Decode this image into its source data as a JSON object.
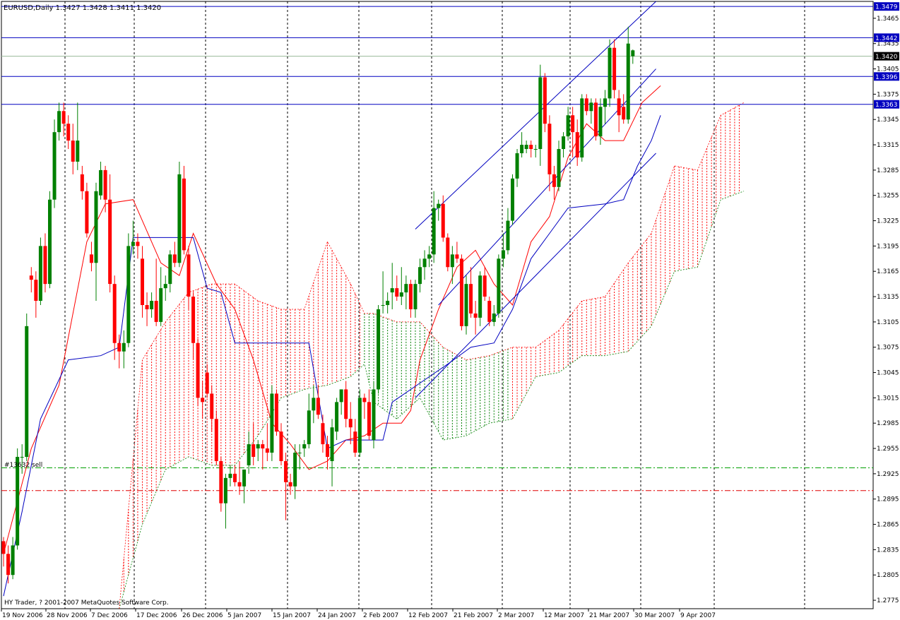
{
  "chart_data": {
    "type": "candlestick",
    "title": "EURUSD,Daily  1.3427 1.3428 1.3411 1.3420",
    "footer": "HY Trader, ? 2001-2007 MetaQuotes Software Corp.",
    "order_label": "#13632 sell",
    "ylim": [
      1.2765,
      1.3485
    ],
    "y_ticks": [
      "1.3465",
      "1.3435",
      "1.3405",
      "1.3375",
      "1.3345",
      "1.3315",
      "1.3285",
      "1.3255",
      "1.3225",
      "1.3195",
      "1.3165",
      "1.3135",
      "1.3105",
      "1.3075",
      "1.3045",
      "1.3015",
      "1.2985",
      "1.2955",
      "1.2925",
      "1.2895",
      "1.2865",
      "1.2835",
      "1.2805",
      "1.2775"
    ],
    "x_ticks": [
      "19 Nov 2006",
      "28 Nov 2006",
      "7 Dec 2006",
      "17 Dec 2006",
      "26 Dec 2006",
      "5 Jan 2007",
      "15 Jan 2007",
      "24 Jan 2007",
      "2 Feb 2007",
      "12 Feb 2007",
      "21 Feb 2007",
      "2 Mar 2007",
      "12 Mar 2007",
      "21 Mar 2007",
      "30 Mar 2007",
      "9 Apr 2007"
    ],
    "levels": [
      {
        "value": 1.3479,
        "label": "1.3479",
        "color": "#0000c0"
      },
      {
        "value": 1.3442,
        "label": "1.3442",
        "color": "#0000c0"
      },
      {
        "value": 1.342,
        "label": "1.3420",
        "color": "#000000"
      },
      {
        "value": 1.3396,
        "label": "1.3396",
        "color": "#0000c0"
      },
      {
        "value": 1.3363,
        "label": "1.3363",
        "color": "#0000c0"
      }
    ],
    "hlines": [
      {
        "value": 1.2932,
        "color": "#00a000",
        "style": "dashdot"
      },
      {
        "value": 1.2905,
        "color": "#e00000",
        "style": "dashdot"
      }
    ],
    "colors": {
      "bull": "#008000",
      "bear": "#ff0000",
      "tenkan": "#ff0000",
      "kijun": "#0000c0",
      "channel": "#0000c0",
      "cloud_bear": "#ff0000",
      "cloud_bull": "#008000"
    },
    "candles": [
      [
        1.2845,
        1.285,
        1.2815,
        1.283
      ],
      [
        1.283,
        1.284,
        1.2795,
        1.2805
      ],
      [
        1.2805,
        1.285,
        1.28,
        1.284
      ],
      [
        1.284,
        1.2955,
        1.2835,
        1.2945
      ],
      [
        1.2945,
        1.296,
        1.2925,
        1.2945
      ],
      [
        1.2945,
        1.3115,
        1.294,
        1.31
      ],
      [
        1.316,
        1.317,
        1.314,
        1.3155
      ],
      [
        1.3155,
        1.3165,
        1.311,
        1.313
      ],
      [
        1.313,
        1.3205,
        1.3125,
        1.3195
      ],
      [
        1.3195,
        1.321,
        1.314,
        1.315
      ],
      [
        1.315,
        1.326,
        1.3145,
        1.325
      ],
      [
        1.325,
        1.3345,
        1.324,
        1.333
      ],
      [
        1.333,
        1.3365,
        1.332,
        1.3355
      ],
      [
        1.3355,
        1.3365,
        1.3325,
        1.334
      ],
      [
        1.334,
        1.335,
        1.331,
        1.332
      ],
      [
        1.332,
        1.334,
        1.328,
        1.3295
      ],
      [
        1.3295,
        1.3365,
        1.3285,
        1.332
      ],
      [
        1.328,
        1.329,
        1.325,
        1.326
      ],
      [
        1.326,
        1.327,
        1.3205,
        1.321
      ],
      [
        1.3185,
        1.32,
        1.3165,
        1.3175
      ],
      [
        1.3175,
        1.327,
        1.313,
        1.326
      ],
      [
        1.3255,
        1.3295,
        1.325,
        1.3285
      ],
      [
        1.3285,
        1.329,
        1.3235,
        1.325
      ],
      [
        1.325,
        1.328,
        1.314,
        1.315
      ],
      [
        1.315,
        1.316,
        1.306,
        1.308
      ],
      [
        1.308,
        1.309,
        1.305,
        1.307
      ],
      [
        1.307,
        1.3095,
        1.305,
        1.308
      ],
      [
        1.308,
        1.321,
        1.3075,
        1.3195
      ],
      [
        1.3195,
        1.3225,
        1.3185,
        1.32
      ],
      [
        1.32,
        1.321,
        1.318,
        1.3195
      ],
      [
        1.318,
        1.3195,
        1.311,
        1.3125
      ],
      [
        1.3125,
        1.314,
        1.31,
        1.312
      ],
      [
        1.312,
        1.314,
        1.311,
        1.313
      ],
      [
        1.313,
        1.318,
        1.31,
        1.3105
      ],
      [
        1.3105,
        1.317,
        1.31,
        1.3145
      ],
      [
        1.3145,
        1.316,
        1.313,
        1.315
      ],
      [
        1.315,
        1.319,
        1.314,
        1.3185
      ],
      [
        1.3185,
        1.32,
        1.317,
        1.3175
      ],
      [
        1.3175,
        1.3295,
        1.317,
        1.328
      ],
      [
        1.3275,
        1.329,
        1.3185,
        1.319
      ],
      [
        1.3185,
        1.3195,
        1.312,
        1.3135
      ],
      [
        1.3135,
        1.314,
        1.306,
        1.308
      ],
      [
        1.308,
        1.3085,
        1.3005,
        1.3015
      ],
      [
        1.3015,
        1.3035,
        1.299,
        1.301
      ],
      [
        1.3045,
        1.3055,
        1.3015,
        1.302
      ],
      [
        1.302,
        1.303,
        1.2975,
        1.299
      ],
      [
        1.299,
        1.3,
        1.2935,
        1.294
      ],
      [
        1.294,
        1.2945,
        1.288,
        1.289
      ],
      [
        1.289,
        1.2925,
        1.286,
        1.292
      ],
      [
        1.292,
        1.2935,
        1.291,
        1.2925
      ],
      [
        1.2925,
        1.2935,
        1.291,
        1.2915
      ],
      [
        1.2915,
        1.294,
        1.29,
        1.291
      ],
      [
        1.291,
        1.293,
        1.289,
        1.293
      ],
      [
        1.2935,
        1.2975,
        1.2925,
        1.296
      ],
      [
        1.296,
        1.2985,
        1.2935,
        1.2945
      ],
      [
        1.2955,
        1.2965,
        1.294,
        1.296
      ],
      [
        1.296,
        1.2965,
        1.293,
        1.2955
      ],
      [
        1.2955,
        1.2985,
        1.294,
        1.295
      ],
      [
        1.295,
        1.303,
        1.294,
        1.302
      ],
      [
        1.302,
        1.3025,
        1.297,
        1.2975
      ],
      [
        1.2975,
        1.2985,
        1.2935,
        1.294
      ],
      [
        1.294,
        1.295,
        1.287,
        1.2915
      ],
      [
        1.2915,
        1.2925,
        1.29,
        1.291
      ],
      [
        1.291,
        1.296,
        1.2895,
        1.295
      ],
      [
        1.295,
        1.296,
        1.293,
        1.295
      ],
      [
        1.2955,
        1.2965,
        1.2945,
        1.296
      ],
      [
        1.296,
        1.302,
        1.2955,
        1.3
      ],
      [
        1.3,
        1.303,
        1.2985,
        1.3015
      ],
      [
        1.3015,
        1.303,
        1.299,
        1.2995
      ],
      [
        1.2985,
        1.2995,
        1.295,
        1.296
      ],
      [
        1.296,
        1.297,
        1.293,
        1.2945
      ],
      [
        1.294,
        1.299,
        1.291,
        1.298
      ],
      [
        1.2975,
        1.3015,
        1.2965,
        1.301
      ],
      [
        1.301,
        1.3025,
        1.2995,
        1.3025
      ],
      [
        1.3025,
        1.3035,
        1.298,
        1.299
      ],
      [
        1.299,
        1.301,
        1.296,
        1.298
      ],
      [
        1.2975,
        1.299,
        1.2945,
        1.295
      ],
      [
        1.295,
        1.3025,
        1.2945,
        1.3015
      ],
      [
        1.3015,
        1.302,
        1.299,
        1.301
      ],
      [
        1.301,
        1.3025,
        1.2965,
        1.297
      ],
      [
        1.2965,
        1.3035,
        1.2955,
        1.3025
      ],
      [
        1.3025,
        1.3125,
        1.302,
        1.312
      ],
      [
        1.3125,
        1.3165,
        1.3115,
        1.3125
      ],
      [
        1.3125,
        1.314,
        1.3115,
        1.313
      ],
      [
        1.314,
        1.3175,
        1.312,
        1.3145
      ],
      [
        1.3145,
        1.316,
        1.313,
        1.3135
      ],
      [
        1.3135,
        1.317,
        1.3125,
        1.314
      ],
      [
        1.314,
        1.316,
        1.312,
        1.315
      ],
      [
        1.315,
        1.3155,
        1.311,
        1.312
      ],
      [
        1.312,
        1.3155,
        1.311,
        1.315
      ],
      [
        1.315,
        1.318,
        1.314,
        1.317
      ],
      [
        1.317,
        1.319,
        1.3155,
        1.318
      ],
      [
        1.318,
        1.3195,
        1.317,
        1.3185
      ],
      [
        1.3185,
        1.326,
        1.3175,
        1.324
      ],
      [
        1.324,
        1.325,
        1.3225,
        1.3245
      ],
      [
        1.3245,
        1.3255,
        1.32,
        1.3205
      ],
      [
        1.3205,
        1.321,
        1.3165,
        1.317
      ],
      [
        1.317,
        1.3195,
        1.315,
        1.3185
      ],
      [
        1.3185,
        1.32,
        1.3175,
        1.318
      ],
      [
        1.318,
        1.3185,
        1.3095,
        1.31
      ],
      [
        1.31,
        1.316,
        1.309,
        1.315
      ],
      [
        1.315,
        1.317,
        1.311,
        1.3115
      ],
      [
        1.3115,
        1.313,
        1.309,
        1.311
      ],
      [
        1.311,
        1.3165,
        1.31,
        1.316
      ],
      [
        1.316,
        1.317,
        1.313,
        1.3135
      ],
      [
        1.313,
        1.3135,
        1.31,
        1.3105
      ],
      [
        1.3105,
        1.3125,
        1.31,
        1.3115
      ],
      [
        1.3115,
        1.3185,
        1.311,
        1.318
      ],
      [
        1.318,
        1.321,
        1.317,
        1.319
      ],
      [
        1.319,
        1.324,
        1.3185,
        1.3225
      ],
      [
        1.3225,
        1.328,
        1.322,
        1.3275
      ],
      [
        1.3275,
        1.331,
        1.3265,
        1.3305
      ],
      [
        1.3305,
        1.333,
        1.33,
        1.3315
      ],
      [
        1.331,
        1.332,
        1.3305,
        1.3315
      ],
      [
        1.3315,
        1.332,
        1.33,
        1.331
      ],
      [
        1.331,
        1.3315,
        1.33,
        1.331
      ],
      [
        1.331,
        1.341,
        1.329,
        1.3395
      ],
      [
        1.3395,
        1.34,
        1.333,
        1.334
      ],
      [
        1.334,
        1.335,
        1.326,
        1.328
      ],
      [
        1.328,
        1.329,
        1.325,
        1.3265
      ],
      [
        1.3265,
        1.332,
        1.326,
        1.331
      ],
      [
        1.331,
        1.333,
        1.33,
        1.3325
      ],
      [
        1.3325,
        1.336,
        1.332,
        1.335
      ],
      [
        1.335,
        1.336,
        1.33,
        1.333
      ],
      [
        1.333,
        1.3345,
        1.329,
        1.33
      ],
      [
        1.33,
        1.3375,
        1.3295,
        1.337
      ],
      [
        1.337,
        1.3375,
        1.335,
        1.3355
      ],
      [
        1.3355,
        1.337,
        1.334,
        1.3365
      ],
      [
        1.3365,
        1.337,
        1.332,
        1.3325
      ],
      [
        1.3325,
        1.337,
        1.3315,
        1.336
      ],
      [
        1.336,
        1.338,
        1.334,
        1.337
      ],
      [
        1.337,
        1.344,
        1.336,
        1.343
      ],
      [
        1.343,
        1.344,
        1.337,
        1.338
      ],
      [
        1.337,
        1.338,
        1.333,
        1.335
      ],
      [
        1.336,
        1.3375,
        1.334,
        1.3345
      ],
      [
        1.3345,
        1.3455,
        1.334,
        1.3435
      ],
      [
        1.342,
        1.3428,
        1.3411,
        1.3427
      ]
    ],
    "tenkan": [
      [
        0,
        1.283
      ],
      [
        6,
        1.2955
      ],
      [
        12,
        1.303
      ],
      [
        18,
        1.32
      ],
      [
        22,
        1.3245
      ],
      [
        28,
        1.325
      ],
      [
        34,
        1.3175
      ],
      [
        38,
        1.316
      ],
      [
        41,
        1.321
      ],
      [
        46,
        1.315
      ],
      [
        50,
        1.312
      ],
      [
        54,
        1.306
      ],
      [
        58,
        1.2985
      ],
      [
        62,
        1.296
      ],
      [
        66,
        1.293
      ],
      [
        70,
        1.294
      ],
      [
        74,
        1.2965
      ],
      [
        78,
        1.297
      ],
      [
        82,
        1.2985
      ],
      [
        86,
        1.2985
      ],
      [
        88,
        1.3
      ],
      [
        90,
        1.306
      ],
      [
        94,
        1.312
      ],
      [
        98,
        1.317
      ],
      [
        102,
        1.319
      ],
      [
        106,
        1.315
      ],
      [
        110,
        1.3125
      ],
      [
        114,
        1.32
      ],
      [
        118,
        1.323
      ],
      [
        122,
        1.33
      ],
      [
        126,
        1.334
      ],
      [
        130,
        1.332
      ],
      [
        134,
        1.332
      ],
      [
        138,
        1.3365
      ],
      [
        142,
        1.3385
      ]
    ],
    "kijun": [
      [
        0,
        1.278
      ],
      [
        4,
        1.288
      ],
      [
        8,
        1.299
      ],
      [
        14,
        1.306
      ],
      [
        21,
        1.3065
      ],
      [
        25,
        1.3075
      ],
      [
        28,
        1.3205
      ],
      [
        41,
        1.3205
      ],
      [
        44,
        1.3145
      ],
      [
        47,
        1.314
      ],
      [
        50,
        1.308
      ],
      [
        66,
        1.308
      ],
      [
        70,
        1.2955
      ],
      [
        74,
        1.2965
      ],
      [
        82,
        1.2965
      ],
      [
        84,
        1.301
      ],
      [
        92,
        1.304
      ],
      [
        96,
        1.3055
      ],
      [
        101,
        1.3075
      ],
      [
        106,
        1.308
      ],
      [
        110,
        1.312
      ],
      [
        114,
        1.318
      ],
      [
        118,
        1.321
      ],
      [
        122,
        1.324
      ],
      [
        130,
        1.3245
      ],
      [
        134,
        1.325
      ],
      [
        137,
        1.329
      ],
      [
        140,
        1.332
      ],
      [
        142,
        1.335
      ]
    ],
    "cloud": [
      [
        25,
        1.2765,
        1.2765
      ],
      [
        30,
        1.2865,
        1.306
      ],
      [
        35,
        1.293,
        1.3105
      ],
      [
        40,
        1.2945,
        1.314
      ],
      [
        45,
        1.2935,
        1.315
      ],
      [
        50,
        1.2935,
        1.315
      ],
      [
        55,
        1.297,
        1.313
      ],
      [
        60,
        1.3015,
        1.312
      ],
      [
        65,
        1.3025,
        1.312
      ],
      [
        70,
        1.303,
        1.32
      ],
      [
        75,
        1.304,
        1.315
      ],
      [
        78,
        1.3055,
        1.3115
      ],
      [
        80,
        1.301,
        1.3115
      ],
      [
        85,
        1.299,
        1.3105
      ],
      [
        90,
        1.3015,
        1.3105
      ],
      [
        95,
        1.2965,
        1.3075
      ],
      [
        100,
        1.297,
        1.306
      ],
      [
        105,
        1.2985,
        1.3065
      ],
      [
        110,
        1.299,
        1.3075
      ],
      [
        115,
        1.304,
        1.3075
      ],
      [
        120,
        1.3045,
        1.3095
      ],
      [
        125,
        1.3065,
        1.313
      ],
      [
        130,
        1.3065,
        1.3135
      ],
      [
        135,
        1.307,
        1.3175
      ],
      [
        140,
        1.31,
        1.321
      ],
      [
        145,
        1.3165,
        1.329
      ],
      [
        150,
        1.317,
        1.3285
      ],
      [
        155,
        1.325,
        1.335
      ],
      [
        160,
        1.326,
        1.3365
      ]
    ],
    "channel_lines": [
      [
        [
          89,
          1.3215
        ],
        [
          141,
          1.3485
        ]
      ],
      [
        [
          89,
          1.3015
        ],
        [
          141,
          1.3305
        ]
      ],
      [
        [
          94,
          1.3125
        ],
        [
          141,
          1.3405
        ]
      ]
    ]
  }
}
